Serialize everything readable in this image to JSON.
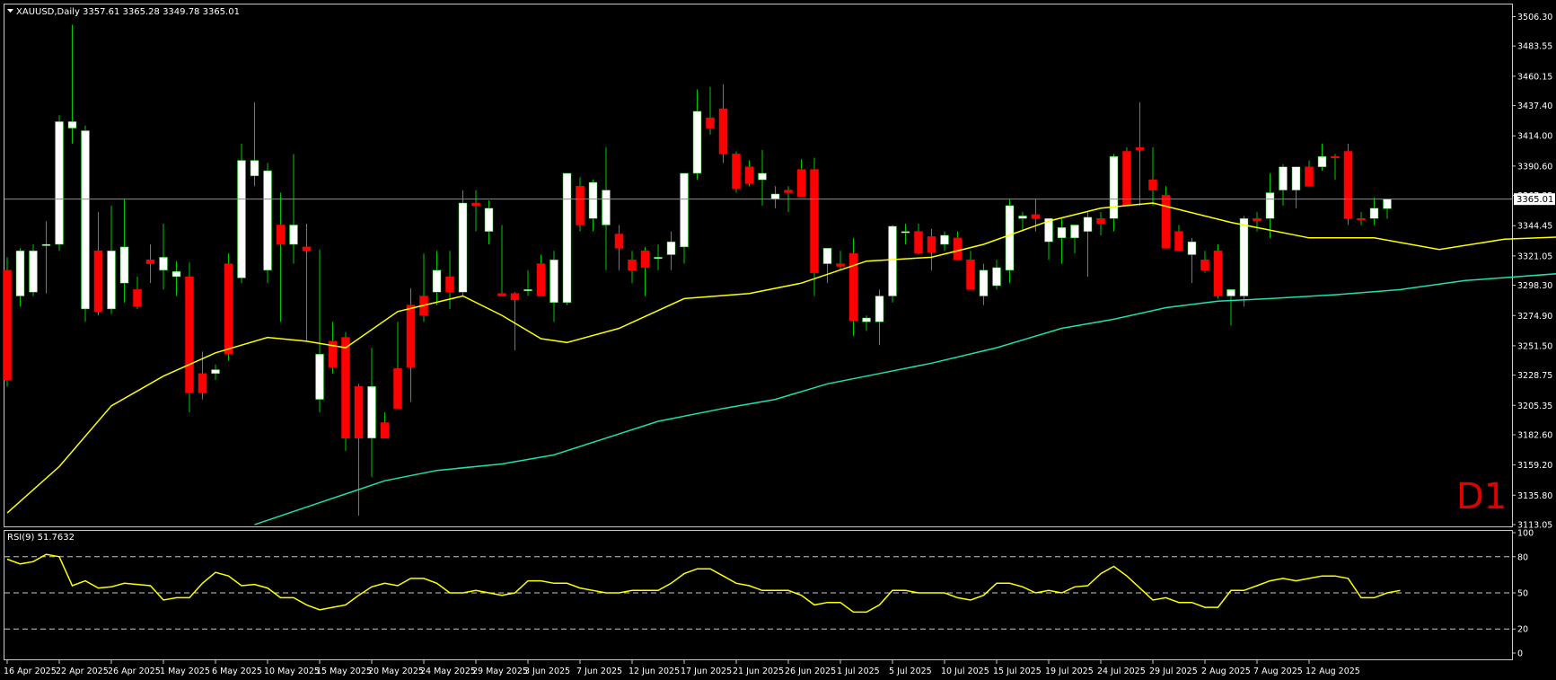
{
  "header": {
    "symbol": "XAUUSD,Daily",
    "ohlc": "3357.61 3365.28 3349.78 3365.01"
  },
  "timeframe_label": "D1",
  "colors": {
    "background": "#000000",
    "frame": "#c8c8c8",
    "bull_body": "#ffffff",
    "bear_body": "#ff0000",
    "wick": "#00c800",
    "ma_fast": "#ffff00",
    "ma_slow": "#20e0b0",
    "price_line": "#8090a0",
    "rsi_line": "#ffff00",
    "text": "#ffffff",
    "d1_label": "#e00000"
  },
  "rsi_panel": {
    "label": "RSI(9) 51.7632",
    "levels": [
      80,
      50,
      20
    ],
    "axis_labels": [
      "100",
      "80",
      "50",
      "20",
      "0"
    ]
  },
  "price_axis": {
    "labels": [
      "3506.30",
      "3483.55",
      "3460.15",
      "3437.40",
      "3414.00",
      "3390.60",
      "3367.85",
      "3344.45",
      "3321.05",
      "3298.30",
      "3274.90",
      "3251.50",
      "3228.75",
      "3205.35",
      "3182.60",
      "3159.20",
      "3135.80",
      "3113.05"
    ],
    "current_price": "3365.01"
  },
  "date_axis": {
    "labels": [
      "16 Apr 2025",
      "22 Apr 2025",
      "26 Apr 2025",
      "1 May 2025",
      "6 May 2025",
      "10 May 2025",
      "15 May 2025",
      "20 May 2025",
      "24 May 2025",
      "29 May 2025",
      "3 Jun 2025",
      "7 Jun 2025",
      "12 Jun 2025",
      "17 Jun 2025",
      "21 Jun 2025",
      "26 Jun 2025",
      "1 Jul 2025",
      "5 Jul 2025",
      "10 Jul 2025",
      "15 Jul 2025",
      "19 Jul 2025",
      "24 Jul 2025",
      "29 Jul 2025",
      "2 Aug 2025",
      "7 Aug 2025",
      "12 Aug 2025"
    ]
  },
  "chart_data": {
    "type": "candlestick",
    "symbol": "XAUUSD",
    "timeframe": "Daily",
    "ylim": [
      3113.05,
      3506.3
    ],
    "candles": [
      [
        3310,
        3320,
        3220,
        3225
      ],
      [
        3290,
        3327,
        3282,
        3325
      ],
      [
        3293,
        3330,
        3290,
        3325
      ],
      [
        3330,
        3348,
        3292,
        3330
      ],
      [
        3330,
        3430,
        3325,
        3425
      ],
      [
        3420,
        3500,
        3408,
        3425
      ],
      [
        3280,
        3422,
        3270,
        3418
      ],
      [
        3325,
        3355,
        3275,
        3278
      ],
      [
        3280,
        3360,
        3276,
        3325
      ],
      [
        3300,
        3365,
        3285,
        3328
      ],
      [
        3295,
        3305,
        3280,
        3282
      ],
      [
        3318,
        3330,
        3300,
        3315
      ],
      [
        3310,
        3346,
        3295,
        3320
      ],
      [
        3305,
        3317,
        3290,
        3309
      ],
      [
        3305,
        3316,
        3200,
        3215
      ],
      [
        3230,
        3247,
        3210,
        3215
      ],
      [
        3230,
        3237,
        3225,
        3233
      ],
      [
        3315,
        3323,
        3240,
        3245
      ],
      [
        3304,
        3408,
        3300,
        3395
      ],
      [
        3383,
        3440,
        3375,
        3395
      ],
      [
        3310,
        3393,
        3300,
        3387
      ],
      [
        3345,
        3370,
        3270,
        3330
      ],
      [
        3330,
        3400,
        3315,
        3345
      ],
      [
        3328,
        3346,
        3255,
        3325
      ],
      [
        3210,
        3326,
        3200,
        3245
      ],
      [
        3255,
        3270,
        3230,
        3235
      ],
      [
        3258,
        3262,
        3170,
        3180
      ],
      [
        3220,
        3222,
        3120,
        3180
      ],
      [
        3180,
        3250,
        3150,
        3220
      ],
      [
        3192,
        3200,
        3180,
        3180
      ],
      [
        3234,
        3270,
        3220,
        3203
      ],
      [
        3283,
        3296,
        3208,
        3235
      ],
      [
        3290,
        3323,
        3270,
        3275
      ],
      [
        3293,
        3325,
        3283,
        3310
      ],
      [
        3305,
        3325,
        3280,
        3293
      ],
      [
        3293,
        3372,
        3290,
        3362
      ],
      [
        3362,
        3372,
        3340,
        3360
      ],
      [
        3340,
        3364,
        3330,
        3358
      ],
      [
        3292,
        3345,
        3290,
        3290
      ],
      [
        3292,
        3293,
        3248,
        3287
      ],
      [
        3295,
        3310,
        3290,
        3295
      ],
      [
        3315,
        3322,
        3290,
        3290
      ],
      [
        3285,
        3325,
        3270,
        3318
      ],
      [
        3285,
        3380,
        3283,
        3385
      ],
      [
        3375,
        3382,
        3340,
        3345
      ],
      [
        3350,
        3380,
        3340,
        3378
      ],
      [
        3345,
        3405,
        3310,
        3372
      ],
      [
        3338,
        3345,
        3310,
        3327
      ],
      [
        3318,
        3325,
        3300,
        3310
      ],
      [
        3325,
        3328,
        3290,
        3312
      ],
      [
        3320,
        3330,
        3310,
        3320
      ],
      [
        3322,
        3340,
        3310,
        3332
      ],
      [
        3328,
        3355,
        3315,
        3385
      ],
      [
        3385,
        3450,
        3380,
        3433
      ],
      [
        3428,
        3452,
        3415,
        3420
      ],
      [
        3435,
        3454,
        3393,
        3400
      ],
      [
        3400,
        3402,
        3370,
        3373
      ],
      [
        3390,
        3395,
        3375,
        3377
      ],
      [
        3380,
        3403,
        3360,
        3385
      ],
      [
        3365,
        3375,
        3358,
        3369
      ],
      [
        3372,
        3375,
        3355,
        3370
      ],
      [
        3388,
        3396,
        3367,
        3367
      ],
      [
        3388,
        3397,
        3290,
        3308
      ],
      [
        3315,
        3324,
        3300,
        3327
      ],
      [
        3315,
        3325,
        3310,
        3313
      ],
      [
        3323,
        3335,
        3259,
        3271
      ],
      [
        3270,
        3275,
        3263,
        3273
      ],
      [
        3270,
        3295,
        3252,
        3290
      ],
      [
        3290,
        3345,
        3285,
        3344
      ],
      [
        3340,
        3346,
        3330,
        3340
      ],
      [
        3340,
        3346,
        3322,
        3323
      ],
      [
        3336,
        3342,
        3310,
        3324
      ],
      [
        3330,
        3340,
        3325,
        3337
      ],
      [
        3335,
        3340,
        3320,
        3318
      ],
      [
        3318,
        3325,
        3305,
        3295
      ],
      [
        3290,
        3315,
        3283,
        3310
      ],
      [
        3298,
        3318,
        3295,
        3312
      ],
      [
        3310,
        3365,
        3300,
        3360
      ],
      [
        3350,
        3355,
        3340,
        3352
      ],
      [
        3353,
        3365,
        3340,
        3350
      ],
      [
        3332,
        3343,
        3318,
        3350
      ],
      [
        3335,
        3350,
        3315,
        3343
      ],
      [
        3335,
        3338,
        3323,
        3345
      ],
      [
        3340,
        3355,
        3305,
        3351
      ],
      [
        3350,
        3355,
        3337,
        3346
      ],
      [
        3350,
        3400,
        3340,
        3398
      ],
      [
        3402,
        3405,
        3372,
        3360
      ],
      [
        3405,
        3440,
        3360,
        3403
      ],
      [
        3380,
        3405,
        3360,
        3372
      ],
      [
        3368,
        3375,
        3340,
        3327
      ],
      [
        3340,
        3345,
        3330,
        3325
      ],
      [
        3322,
        3335,
        3300,
        3332
      ],
      [
        3318,
        3325,
        3308,
        3310
      ],
      [
        3325,
        3330,
        3288,
        3290
      ],
      [
        3290,
        3293,
        3267,
        3295
      ],
      [
        3290,
        3352,
        3282,
        3350
      ],
      [
        3350,
        3355,
        3340,
        3348
      ],
      [
        3350,
        3385,
        3335,
        3370
      ],
      [
        3372,
        3392,
        3360,
        3390
      ],
      [
        3372,
        3390,
        3358,
        3390
      ],
      [
        3390,
        3395,
        3375,
        3375
      ],
      [
        3390,
        3408,
        3387,
        3398
      ],
      [
        3398,
        3400,
        3380,
        3397
      ],
      [
        3402,
        3408,
        3345,
        3350
      ],
      [
        3350,
        3355,
        3345,
        3349
      ],
      [
        3350,
        3366,
        3345,
        3358
      ],
      [
        3357.61,
        3365.28,
        3349.78,
        3365.01
      ]
    ],
    "ma_fast": {
      "name": "MA fast",
      "points": [
        [
          0,
          3122
        ],
        [
          4,
          3158
        ],
        [
          8,
          3205
        ],
        [
          12,
          3228
        ],
        [
          16,
          3246
        ],
        [
          20,
          3258
        ],
        [
          23,
          3255
        ],
        [
          26,
          3250
        ],
        [
          30,
          3278
        ],
        [
          35,
          3290
        ],
        [
          38,
          3275
        ],
        [
          41,
          3257
        ],
        [
          43,
          3254
        ],
        [
          47,
          3265
        ],
        [
          52,
          3288
        ],
        [
          57,
          3292
        ],
        [
          61,
          3300
        ],
        [
          66,
          3317
        ],
        [
          71,
          3320
        ],
        [
          75,
          3330
        ],
        [
          80,
          3348
        ],
        [
          84,
          3358
        ],
        [
          88,
          3362
        ],
        [
          94,
          3347
        ],
        [
          100,
          3335
        ],
        [
          105,
          3335
        ],
        [
          110,
          3326
        ],
        [
          115,
          3334
        ],
        [
          120,
          3336
        ],
        [
          125,
          3340
        ],
        [
          128,
          3355
        ],
        [
          133,
          3355
        ],
        [
          137,
          3345
        ],
        [
          140,
          3336
        ],
        [
          145,
          3342
        ],
        [
          150,
          3350
        ],
        [
          154,
          3360
        ],
        [
          158,
          3358
        ],
        [
          162,
          3356
        ]
      ]
    },
    "ma_slow": {
      "name": "MA slow",
      "points": [
        [
          19,
          3113
        ],
        [
          24,
          3130
        ],
        [
          29,
          3147
        ],
        [
          33,
          3155
        ],
        [
          38,
          3160
        ],
        [
          42,
          3167
        ],
        [
          46,
          3180
        ],
        [
          50,
          3193
        ],
        [
          55,
          3203
        ],
        [
          59,
          3210
        ],
        [
          63,
          3222
        ],
        [
          67,
          3230
        ],
        [
          71,
          3238
        ],
        [
          76,
          3250
        ],
        [
          81,
          3265
        ],
        [
          85,
          3272
        ],
        [
          89,
          3281
        ],
        [
          93,
          3286
        ],
        [
          97,
          3288
        ],
        [
          102,
          3291
        ],
        [
          107,
          3295
        ],
        [
          112,
          3302
        ],
        [
          116,
          3305
        ],
        [
          120,
          3308
        ],
        [
          124,
          3314
        ],
        [
          128,
          3318
        ],
        [
          133,
          3318
        ],
        [
          137,
          3318
        ],
        [
          141,
          3320
        ],
        [
          145,
          3326
        ],
        [
          150,
          3330
        ],
        [
          154,
          3333
        ],
        [
          158,
          3334
        ],
        [
          162,
          3337
        ]
      ]
    },
    "rsi": {
      "name": "RSI(9)",
      "period": 9,
      "ylim": [
        0,
        100
      ],
      "values": [
        78,
        74,
        76,
        82,
        80,
        56,
        60,
        54,
        55,
        58,
        57,
        56,
        44,
        46,
        46,
        58,
        67,
        64,
        56,
        57,
        54,
        46,
        46,
        40,
        36,
        38,
        40,
        48,
        55,
        58,
        56,
        62,
        62,
        58,
        50,
        50,
        52,
        50,
        48,
        50,
        60,
        60,
        58,
        58,
        54,
        52,
        50,
        50,
        52,
        52,
        52,
        58,
        66,
        70,
        70,
        64,
        58,
        56,
        52,
        52,
        52,
        48,
        40,
        42,
        42,
        34,
        34,
        40,
        52,
        52,
        50,
        50,
        50,
        46,
        44,
        48,
        58,
        58,
        55,
        50,
        52,
        50,
        55,
        56,
        66,
        72,
        64,
        54,
        44,
        46,
        42,
        42,
        38,
        38,
        52,
        52,
        56,
        60,
        62,
        60,
        62,
        64,
        64,
        62,
        46,
        46,
        50,
        52
      ]
    }
  }
}
